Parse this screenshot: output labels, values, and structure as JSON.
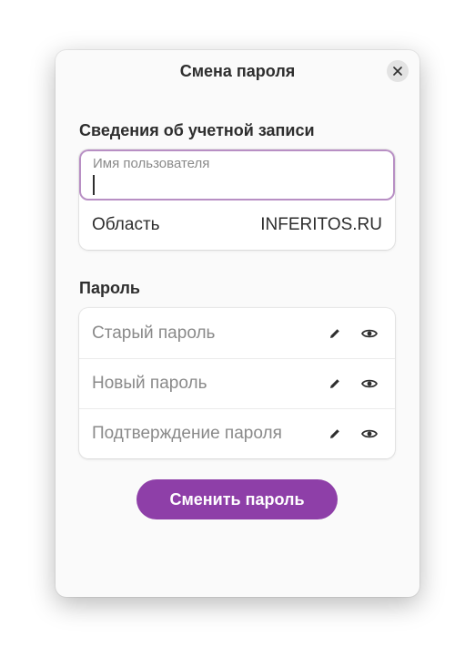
{
  "dialog": {
    "title": "Смена пароля",
    "close_icon": "close-icon"
  },
  "account": {
    "section_title": "Сведения об учетной записи",
    "username": {
      "label": "Имя пользователя",
      "value": ""
    },
    "realm": {
      "label": "Область",
      "value": "INFERITOS.RU"
    }
  },
  "password": {
    "section_title": "Пароль",
    "fields": [
      {
        "placeholder": "Старый пароль",
        "edit_icon": "pencil-icon",
        "reveal_icon": "eye-icon"
      },
      {
        "placeholder": "Новый пароль",
        "edit_icon": "pencil-icon",
        "reveal_icon": "eye-icon"
      },
      {
        "placeholder": "Подтверждение пароля",
        "edit_icon": "pencil-icon",
        "reveal_icon": "eye-icon"
      }
    ]
  },
  "submit_label": "Сменить пароль",
  "colors": {
    "accent": "#8e3fa8",
    "focus_border": "#b88fc4",
    "dialog_bg": "#fafafa"
  }
}
